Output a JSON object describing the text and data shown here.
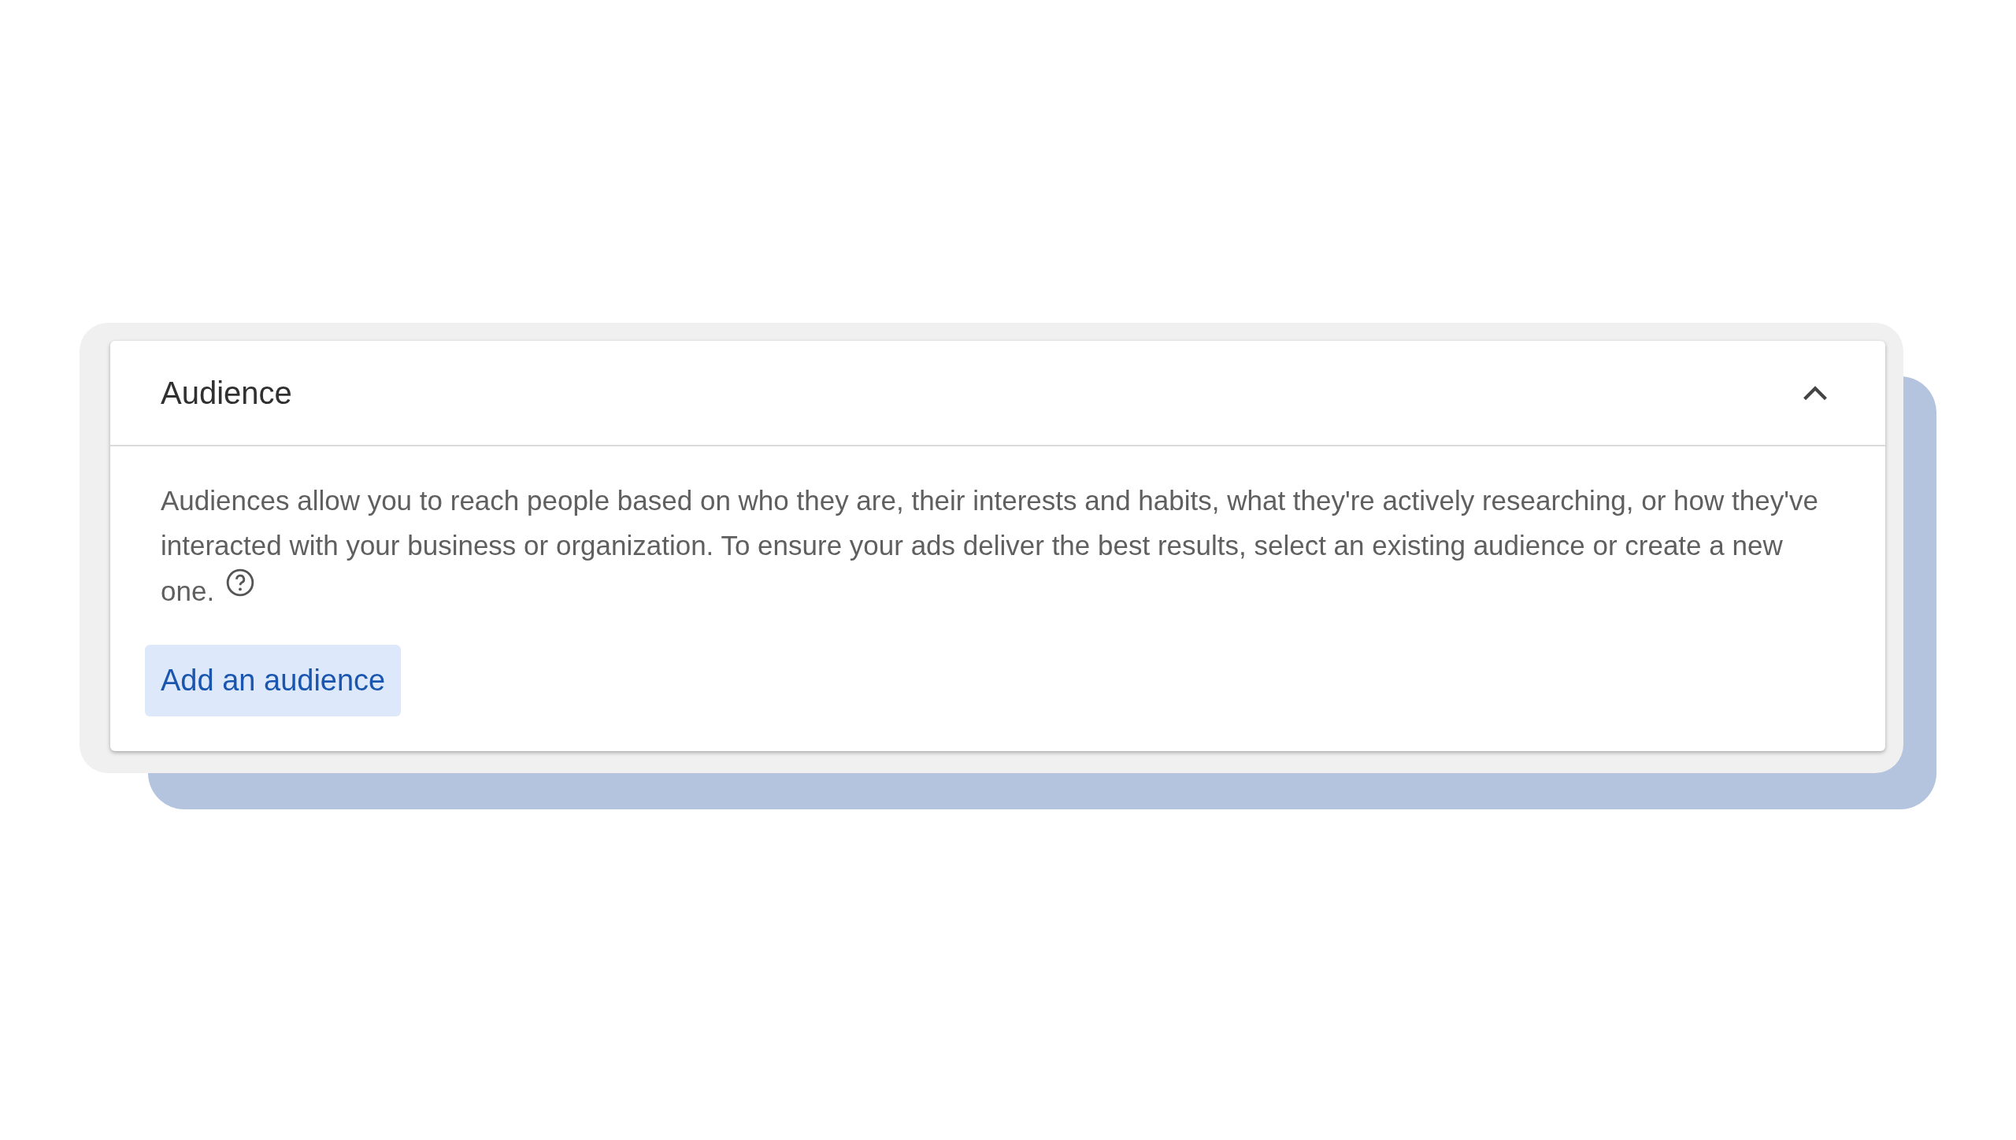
{
  "panel": {
    "title": "Audience",
    "expanded": true,
    "description": "Audiences allow you to reach people based on who they are, their interests and habits, what they're actively researching, or how they've interacted with your business or organization. To ensure your ads deliver the best results, select an existing audience or create a new one.",
    "button": "Add an audience"
  }
}
